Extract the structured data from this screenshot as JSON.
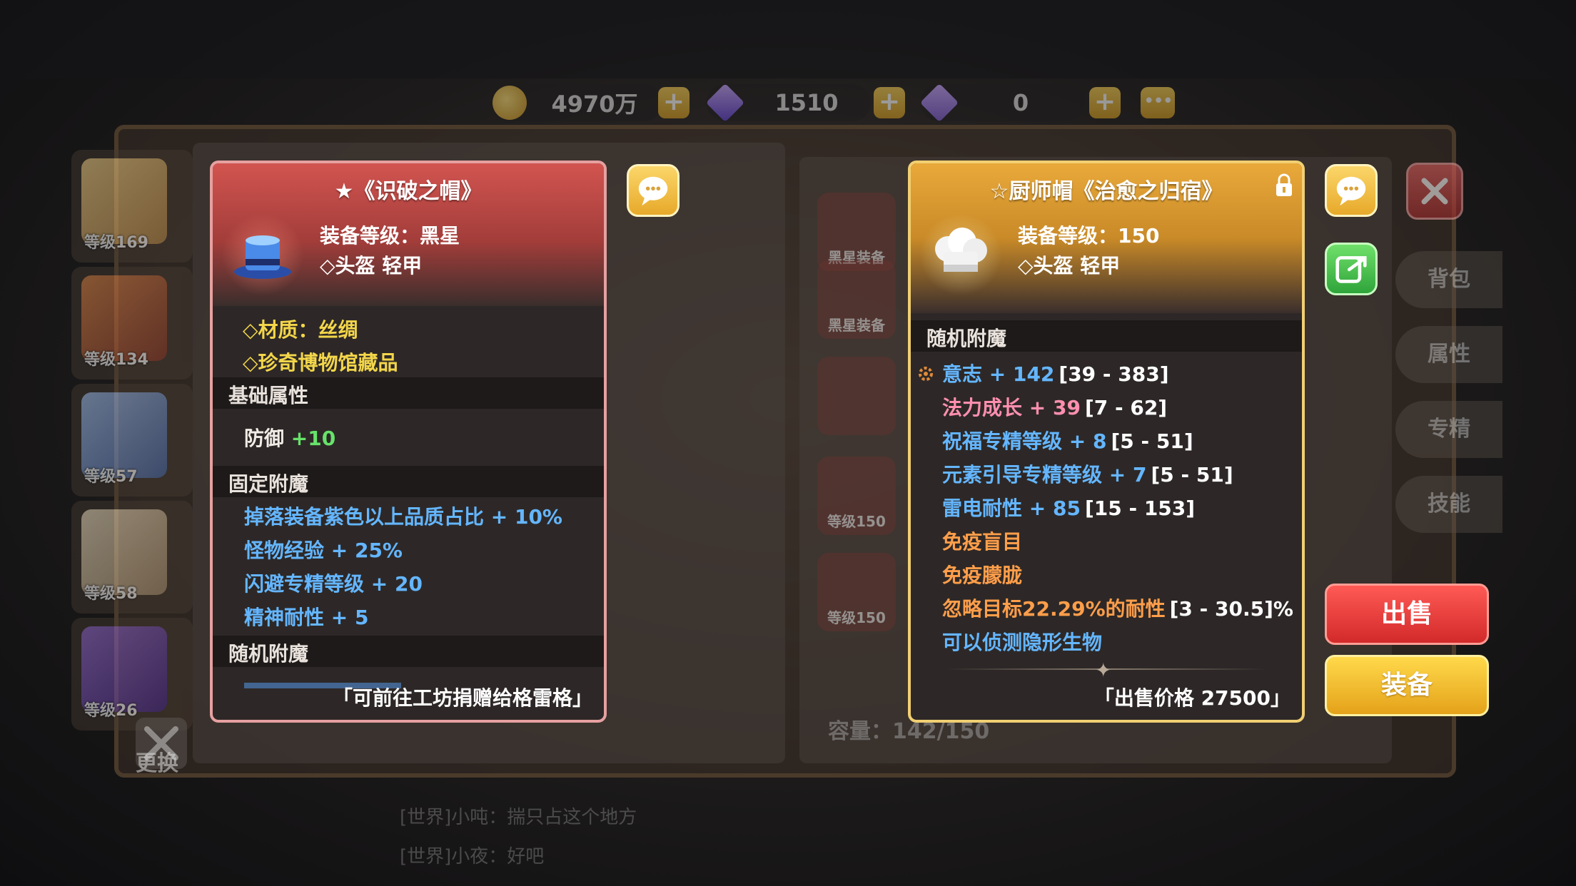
{
  "currency": {
    "gold": "4970万",
    "diamond": "1510",
    "crystal": "0"
  },
  "heroes": [
    {
      "level": "等级169"
    },
    {
      "level": "等级134"
    },
    {
      "level": "等级57"
    },
    {
      "level": "等级58"
    },
    {
      "level": "等级26"
    }
  ],
  "change_label": "更换",
  "bg_items": [
    {
      "label": "黑星装备"
    },
    {
      "label": "黑星装备"
    },
    {
      "label": ""
    },
    {
      "label": "等级150"
    },
    {
      "label": "等级150"
    }
  ],
  "tabs": [
    "背包",
    "属性",
    "专精",
    "技能"
  ],
  "chat": [
    "[世界]小吨：揣只占这个地方",
    "[世界]小夜：好吧"
  ],
  "capacity": "容量：142/150",
  "left_card": {
    "title": "★《识破之帽》",
    "level_line": "装备等级：黑星",
    "type_line": "◇头盔  轻甲",
    "material": "◇材质：丝绸",
    "museum": "◇珍奇博物馆藏品",
    "section_base": "基础属性",
    "base_stat_name": "防御",
    "base_stat_value": "+10",
    "section_fixed": "固定附魔",
    "fixed": [
      "掉落装备紫色以上品质占比 + 10%",
      "怪物经验 + 25%",
      "闪避专精等级 + 20",
      "精神耐性 + 5"
    ],
    "section_random": "随机附魔",
    "footer": "「可前往工坊捐赠给格雷格」"
  },
  "right_card": {
    "title": "☆厨师帽《治愈之归宿》",
    "level_line": "装备等级：150",
    "type_line": "◇头盔  轻甲",
    "section_random": "随机附魔",
    "random": [
      {
        "text": "意志 + 142",
        "range": "[39 - 383]",
        "color": "#64b6ff"
      },
      {
        "text": "法力成长 + 39",
        "range": "[7 - 62]",
        "color": "#ff8fb0"
      },
      {
        "text": "祝福专精等级 + 8",
        "range": "[5 - 51]",
        "color": "#64b6ff"
      },
      {
        "text": "元素引导专精等级 + 7",
        "range": "[5 - 51]",
        "color": "#64b6ff"
      },
      {
        "text": "雷电耐性 + 85",
        "range": "[15 - 153]",
        "color": "#64b6ff"
      },
      {
        "text": "免疫盲目",
        "range": "",
        "color": "#ff9e4a"
      },
      {
        "text": "免疫朦胧",
        "range": "",
        "color": "#ff9e4a"
      },
      {
        "text": "忽略目标22.29%的耐性",
        "range": "[3 - 30.5]%",
        "color": "#ff9e4a"
      },
      {
        "text": "可以侦测隐形生物",
        "range": "",
        "color": "#64b6ff"
      }
    ],
    "footer": "「出售价格 27500」"
  },
  "buttons": {
    "sell": "出售",
    "equip": "装备"
  },
  "colors": {
    "left_card_accent": "#c84a46",
    "right_card_accent": "#e9a93a",
    "sell_red": "#e03a36",
    "equip_gold": "#f2bd2e"
  }
}
